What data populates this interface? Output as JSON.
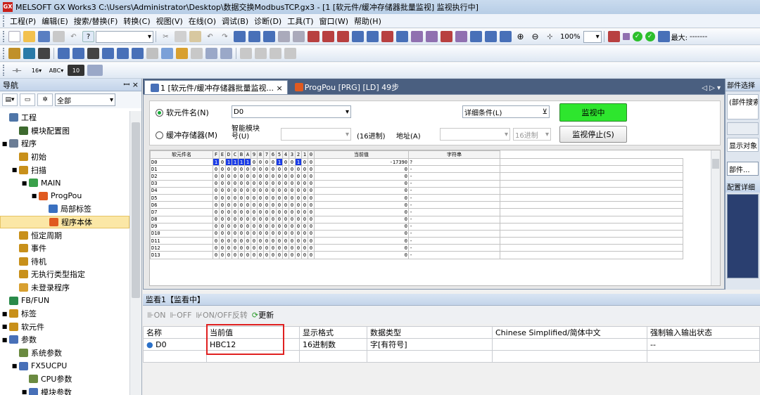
{
  "window": {
    "title": "MELSOFT GX Works3 C:\\Users\\Administrator\\Desktop\\数据交换ModbusTCP.gx3 - [1 [软元件/缓冲存储器批量监视] 监视执行中]",
    "icon_text": "GX"
  },
  "menu": [
    "工程(P)",
    "编辑(E)",
    "搜索/替换(F)",
    "转换(C)",
    "视图(V)",
    "在线(O)",
    "调试(B)",
    "诊断(D)",
    "工具(T)",
    "窗口(W)",
    "帮助(H)"
  ],
  "toolbar": {
    "zoom": "100%",
    "max_label": "最大:",
    "max_value": "-------"
  },
  "nav": {
    "title": "导航",
    "pin": "ꟷ ×",
    "filter": "全部",
    "items": [
      {
        "label": "工程",
        "indent": 0,
        "exp": ""
      },
      {
        "label": "模块配置图",
        "indent": 1,
        "exp": ""
      },
      {
        "label": "程序",
        "indent": 0,
        "exp": "■"
      },
      {
        "label": "初始",
        "indent": 1,
        "exp": ""
      },
      {
        "label": "扫描",
        "indent": 1,
        "exp": "■"
      },
      {
        "label": "MAIN",
        "indent": 2,
        "exp": "■"
      },
      {
        "label": "ProgPou",
        "indent": 3,
        "exp": "■"
      },
      {
        "label": "局部标签",
        "indent": 4,
        "exp": ""
      },
      {
        "label": "程序本体",
        "indent": 4,
        "exp": "",
        "selected": true
      },
      {
        "label": "恒定周期",
        "indent": 1,
        "exp": ""
      },
      {
        "label": "事件",
        "indent": 1,
        "exp": ""
      },
      {
        "label": "待机",
        "indent": 1,
        "exp": ""
      },
      {
        "label": "无执行类型指定",
        "indent": 1,
        "exp": ""
      },
      {
        "label": "未登录程序",
        "indent": 1,
        "exp": ""
      },
      {
        "label": "FB/FUN",
        "indent": 0,
        "exp": ""
      },
      {
        "label": "标签",
        "indent": 0,
        "exp": "■"
      },
      {
        "label": "软元件",
        "indent": 0,
        "exp": "■"
      },
      {
        "label": "参数",
        "indent": 0,
        "exp": "■"
      },
      {
        "label": "系统参数",
        "indent": 1,
        "exp": ""
      },
      {
        "label": "FX5UCPU",
        "indent": 1,
        "exp": "■"
      },
      {
        "label": "CPU参数",
        "indent": 2,
        "exp": ""
      },
      {
        "label": "模块参数",
        "indent": 2,
        "exp": "■"
      }
    ]
  },
  "tabs": [
    {
      "label": "1 [软元件/缓冲存储器批量监视... ×"
    },
    {
      "label": "ProgPou [PRG] [LD] 49步"
    }
  ],
  "tab_nav": "◁ ▷ ▾",
  "monitor": {
    "radio_device": "软元件名(N)",
    "device_value": "D0",
    "detail_cond": "详细条件(L)",
    "monitoring_btn": "监视中",
    "radio_buffer": "缓冲存储器(M)",
    "smart_module_1": "智能模块",
    "smart_module_2": "号(U)",
    "hex_label": "(16进制)",
    "address_label": "地址(A)",
    "hex_select": "16进制",
    "stop_btn": "监视停止(S)"
  },
  "grid": {
    "headers": [
      "软元件名",
      "F",
      "E",
      "D",
      "C",
      "B",
      "A",
      "9",
      "8",
      "7",
      "6",
      "5",
      "4",
      "3",
      "2",
      "1",
      "0",
      "当前值",
      "字符串"
    ],
    "rows": [
      {
        "dev": "D0",
        "bits": [
          1,
          0,
          1,
          1,
          1,
          1,
          0,
          0,
          0,
          0,
          1,
          0,
          0,
          1,
          0,
          0
        ],
        "cur": "-17390",
        "str": "?"
      },
      {
        "dev": "D1",
        "bits": [
          0,
          0,
          0,
          0,
          0,
          0,
          0,
          0,
          0,
          0,
          0,
          0,
          0,
          0,
          0,
          0
        ],
        "cur": "0",
        "str": "-"
      },
      {
        "dev": "D2",
        "bits": [
          0,
          0,
          0,
          0,
          0,
          0,
          0,
          0,
          0,
          0,
          0,
          0,
          0,
          0,
          0,
          0
        ],
        "cur": "0",
        "str": "-"
      },
      {
        "dev": "D3",
        "bits": [
          0,
          0,
          0,
          0,
          0,
          0,
          0,
          0,
          0,
          0,
          0,
          0,
          0,
          0,
          0,
          0
        ],
        "cur": "0",
        "str": "-"
      },
      {
        "dev": "D4",
        "bits": [
          0,
          0,
          0,
          0,
          0,
          0,
          0,
          0,
          0,
          0,
          0,
          0,
          0,
          0,
          0,
          0
        ],
        "cur": "0",
        "str": "-"
      },
      {
        "dev": "D5",
        "bits": [
          0,
          0,
          0,
          0,
          0,
          0,
          0,
          0,
          0,
          0,
          0,
          0,
          0,
          0,
          0,
          0
        ],
        "cur": "0",
        "str": "-"
      },
      {
        "dev": "D6",
        "bits": [
          0,
          0,
          0,
          0,
          0,
          0,
          0,
          0,
          0,
          0,
          0,
          0,
          0,
          0,
          0,
          0
        ],
        "cur": "0",
        "str": "-"
      },
      {
        "dev": "D7",
        "bits": [
          0,
          0,
          0,
          0,
          0,
          0,
          0,
          0,
          0,
          0,
          0,
          0,
          0,
          0,
          0,
          0
        ],
        "cur": "0",
        "str": "-"
      },
      {
        "dev": "D8",
        "bits": [
          0,
          0,
          0,
          0,
          0,
          0,
          0,
          0,
          0,
          0,
          0,
          0,
          0,
          0,
          0,
          0
        ],
        "cur": "0",
        "str": "-"
      },
      {
        "dev": "D9",
        "bits": [
          0,
          0,
          0,
          0,
          0,
          0,
          0,
          0,
          0,
          0,
          0,
          0,
          0,
          0,
          0,
          0
        ],
        "cur": "0",
        "str": "-"
      },
      {
        "dev": "D10",
        "bits": [
          0,
          0,
          0,
          0,
          0,
          0,
          0,
          0,
          0,
          0,
          0,
          0,
          0,
          0,
          0,
          0
        ],
        "cur": "0",
        "str": "-"
      },
      {
        "dev": "D11",
        "bits": [
          0,
          0,
          0,
          0,
          0,
          0,
          0,
          0,
          0,
          0,
          0,
          0,
          0,
          0,
          0,
          0
        ],
        "cur": "0",
        "str": "-"
      },
      {
        "dev": "D12",
        "bits": [
          0,
          0,
          0,
          0,
          0,
          0,
          0,
          0,
          0,
          0,
          0,
          0,
          0,
          0,
          0,
          0
        ],
        "cur": "0",
        "str": "-"
      },
      {
        "dev": "D13",
        "bits": [
          0,
          0,
          0,
          0,
          0,
          0,
          0,
          0,
          0,
          0,
          0,
          0,
          0,
          0,
          0,
          0
        ],
        "cur": "0",
        "str": "-"
      }
    ]
  },
  "right_panel": {
    "title": "部件选择",
    "search": "(部件搜索",
    "display_target": "显示对象",
    "parts_btn": "部件...",
    "config_detail": "配置详细"
  },
  "watch": {
    "title": "监看1【监看中】",
    "btn_on": "ON",
    "btn_off": "OFF",
    "btn_toggle": "ON/OFF反转",
    "btn_update": "更新",
    "columns": [
      "名称",
      "当前值",
      "显示格式",
      "数据类型",
      "Chinese Simplified/简体中文",
      "强制输入输出状态"
    ],
    "rows": [
      {
        "name": "D0",
        "value": "HBC12",
        "format": "16进制数",
        "type": "字[有符号]",
        "comment": "",
        "force": "--"
      }
    ]
  }
}
